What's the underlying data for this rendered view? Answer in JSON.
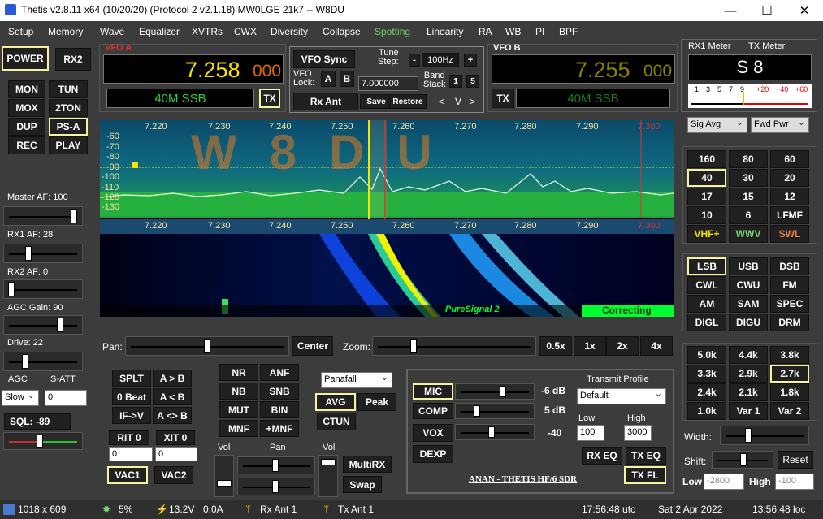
{
  "window": {
    "title": "Thetis v2.8.11 x64 (10/20/20) (Protocol 2 v2.1.18) MW0LGE 21k7  --  W8DU",
    "minimize": "—",
    "maximize": "☐",
    "close": "✕"
  },
  "menu": [
    "Setup",
    "Memory",
    "Wave",
    "Equalizer",
    "XVTRs",
    "CWX",
    "Diversity",
    "Collapse",
    "Spotting",
    "Linearity",
    "RA",
    "WB",
    "PI",
    "BPF"
  ],
  "left_buttons": {
    "power": "POWER",
    "rx2": "RX2",
    "mon": "MON",
    "tun": "TUN",
    "mox": "MOX",
    "ton2": "2TON",
    "dup": "DUP",
    "psa": "PS-A",
    "rec": "REC",
    "play": "PLAY"
  },
  "left_labels": {
    "master_af": "Master AF:  100",
    "rx1_af": "RX1 AF:  28",
    "rx2_af": "RX2 AF:  0",
    "agc_gain": "AGC Gain:  90",
    "drive": "Drive:  22",
    "agc": "AGC",
    "satt": "S-ATT",
    "agc_value": "Slow",
    "satt_value": "0",
    "sql": "SQL:  -89"
  },
  "levels": {
    "master_af": 100,
    "rx1_af": 28,
    "rx2_af": 0,
    "agc_gain": 90,
    "drive": 22
  },
  "vfo_a": {
    "label": "VFO A",
    "freq": "7.258",
    "freq_sub": "000",
    "mode": "40M SSB",
    "tx": "TX"
  },
  "vfo_b": {
    "label": "VFO B",
    "freq": "7.255",
    "freq_sub": "000",
    "mode": "40M SSB",
    "tx": "TX"
  },
  "center": {
    "vfo_sync": "VFO Sync",
    "tune_step_label": "Tune\nStep:",
    "tune_minus": "-",
    "tune_step": "100Hz",
    "tune_plus": "+",
    "vfo_lock": "VFO\nLock:",
    "lock_a": "A",
    "lock_b": "B",
    "lock_freq": "7.000000",
    "band_stack": "Band\nStack",
    "band_stack_1": "1",
    "band_stack_5": "5",
    "rx_ant": "Rx Ant",
    "save": "Save",
    "restore": "Restore",
    "lt": "<",
    "v": "V",
    "gt": ">"
  },
  "meter": {
    "rx1_label": "RX1 Meter",
    "tx_label": "TX Meter",
    "reading": "S 8",
    "scale": [
      "1",
      "3",
      "5",
      "7",
      "9",
      "+20",
      "+40",
      "+60"
    ],
    "rx_mode": "Sig Avg",
    "tx_mode": "Fwd Pwr"
  },
  "spectrum": {
    "freq_ticks": [
      "7.220",
      "7.230",
      "7.240",
      "7.250",
      "7.260",
      "7.270",
      "7.280",
      "7.290",
      "7.300"
    ],
    "db_ticks": [
      "-60",
      "-70",
      "-80",
      "-90",
      "-100",
      "-110",
      "-120",
      "-130"
    ],
    "overlay": "W8DU",
    "puresignal": "PureSignal 2",
    "correcting": "Correcting"
  },
  "bands": [
    "160",
    "80",
    "60",
    "40",
    "30",
    "20",
    "17",
    "15",
    "12",
    "10",
    "6",
    "LFMF",
    "VHF+",
    "WWV",
    "SWL"
  ],
  "modes": [
    "LSB",
    "USB",
    "DSB",
    "CWL",
    "CWU",
    "FM",
    "AM",
    "SAM",
    "SPEC",
    "DIGL",
    "DIGU",
    "DRM"
  ],
  "filters": [
    "5.0k",
    "4.4k",
    "3.8k",
    "3.3k",
    "2.9k",
    "2.7k",
    "2.4k",
    "2.1k",
    "1.8k",
    "1.0k",
    "Var 1",
    "Var 2"
  ],
  "filter_ctrl": {
    "width": "Width:",
    "shift": "Shift:",
    "reset": "Reset",
    "low": "Low",
    "low_val": "-2800",
    "high": "High",
    "high_val": "-100"
  },
  "pan_zoom": {
    "pan": "Pan:",
    "center": "Center",
    "zoom": "Zoom:",
    "z05": "0.5x",
    "z1": "1x",
    "z2": "2x",
    "z4": "4x"
  },
  "split": {
    "splt": "SPLT",
    "a2b": "A > B",
    "beat": "0 Beat",
    "a_b": "A < B",
    "ifv": "IF->V",
    "aswap": "A <> B",
    "rit": "RIT",
    "rit_val": "0",
    "xit": "XIT",
    "xit_val": "0",
    "rit_spin": "0",
    "xit_spin": "0",
    "vac1": "VAC1",
    "vac2": "VAC2"
  },
  "dsp": {
    "nr": "NR",
    "anf": "ANF",
    "nb": "NB",
    "snb": "SNB",
    "mut": "MUT",
    "bin": "BIN",
    "mnf": "MNF",
    "pmnf": "+MNF",
    "display": "Panafall",
    "avg": "AVG",
    "peak": "Peak",
    "ctun": "CTUN"
  },
  "multirx": {
    "vol": "Vol",
    "pan": "Pan",
    "vol2": "Vol",
    "multirx": "MultiRX",
    "swap": "Swap"
  },
  "tx": {
    "mic": "MIC",
    "mic_db": "-6 dB",
    "comp": "COMP",
    "comp_db": "5 dB",
    "vox": "VOX",
    "vox_db": "-40",
    "dexp": "DEXP",
    "profile_label": "Transmit Profile",
    "profile": "Default",
    "low_label": "Low",
    "low": "100",
    "high_label": "High",
    "high": "3000",
    "rx_eq": "RX EQ",
    "tx_eq": "TX EQ",
    "tx_fl": "TX FL",
    "brand": "ANAN - THETIS HF/6 SDR"
  },
  "status": {
    "res": "1018 x 609",
    "cpu": "5%",
    "volt": "13.2V",
    "amp": "0.0A",
    "rx_ant": "Rx Ant  1",
    "tx_ant": "Tx Ant  1",
    "utc": "17:56:48 utc",
    "date": "Sat 2 Apr 2022",
    "loc": "13:56:48 loc"
  },
  "colors": {
    "accent_yellow": "#f5f2a0",
    "vfo_a_freq": "#f5e000",
    "vfo_b_freq": "#8a8000",
    "mode_green": "#2ecc40",
    "puresignal_green": "#00ff30"
  }
}
